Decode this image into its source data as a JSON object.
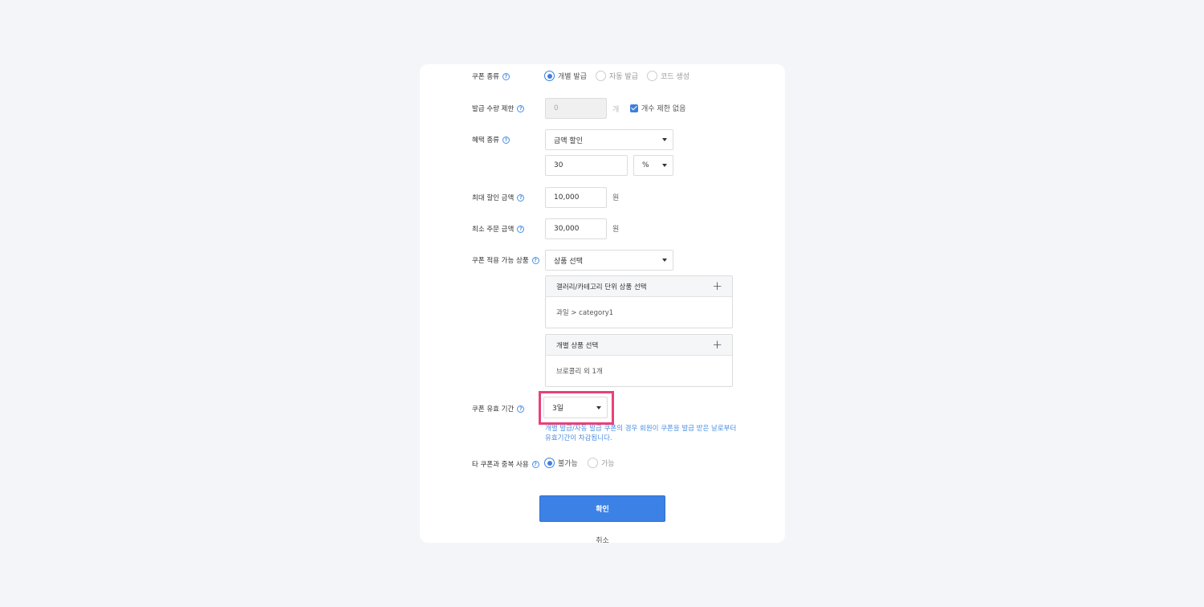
{
  "form": {
    "coupon_type": {
      "label": "쿠폰 종류",
      "options": [
        {
          "label": "개별 발급",
          "selected": true
        },
        {
          "label": "자동 발급",
          "selected": false
        },
        {
          "label": "코드 생성",
          "selected": false
        }
      ]
    },
    "issue_limit": {
      "label": "발급 수량 제한",
      "value": "0",
      "unit": "개",
      "checkbox_label": "개수 제한 없음",
      "checked": true
    },
    "benefit_type": {
      "label": "혜택 종류",
      "selected": "금액 할인",
      "amount": "30",
      "amount_unit": "%"
    },
    "max_discount": {
      "label": "최대 할인 금액",
      "value": "10,000",
      "unit": "원"
    },
    "min_order": {
      "label": "최소 주문 금액",
      "value": "30,000",
      "unit": "원"
    },
    "applicable_products": {
      "label": "쿠폰 적용 가능 상품",
      "selected": "상품 선택",
      "category_box": {
        "title": "갤러리/카테고리 단위 상품 선택",
        "content": "과일 > category1"
      },
      "product_box": {
        "title": "개별 상품 선택",
        "content": "브로콜리 외 1개"
      }
    },
    "validity": {
      "label": "쿠폰 유효 기간",
      "selected": "3일",
      "note_line1": "개별 발급/자동 발급 쿠폰의 경우 회원이 쿠폰을 발급 받은 날로부터",
      "note_line2": "유효기간이 차감됩니다."
    },
    "duplicate_use": {
      "label": "타 쿠폰과 중복 사용",
      "options": [
        {
          "label": "불가능",
          "selected": true
        },
        {
          "label": "가능",
          "selected": false
        }
      ]
    },
    "help_glyph": "?",
    "plus_glyph": "+",
    "confirm_label": "확인",
    "cancel_label": "취소"
  },
  "colors": {
    "accent": "#3c82e6",
    "highlight": "#e8417a",
    "note": "#4a8fe6",
    "background": "#f4f5f8"
  }
}
